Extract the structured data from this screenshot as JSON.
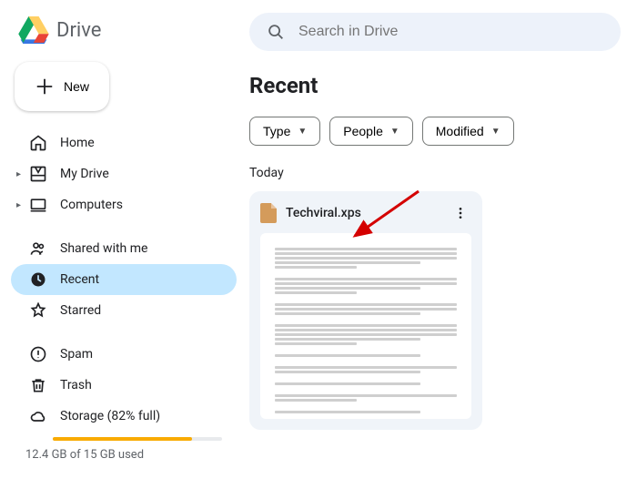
{
  "app_name": "Drive",
  "new_button": "New",
  "search": {
    "placeholder": "Search in Drive"
  },
  "nav": {
    "home": "Home",
    "my_drive": "My Drive",
    "computers": "Computers",
    "shared": "Shared with me",
    "recent": "Recent",
    "starred": "Starred",
    "spam": "Spam",
    "trash": "Trash",
    "storage": "Storage (82% full)"
  },
  "storage": {
    "used_text": "12.4 GB of 15 GB used",
    "percent": 82
  },
  "page": {
    "title": "Recent"
  },
  "filters": {
    "type": "Type",
    "people": "People",
    "modified": "Modified"
  },
  "section": {
    "today": "Today"
  },
  "file": {
    "name": "Techviral.xps"
  }
}
